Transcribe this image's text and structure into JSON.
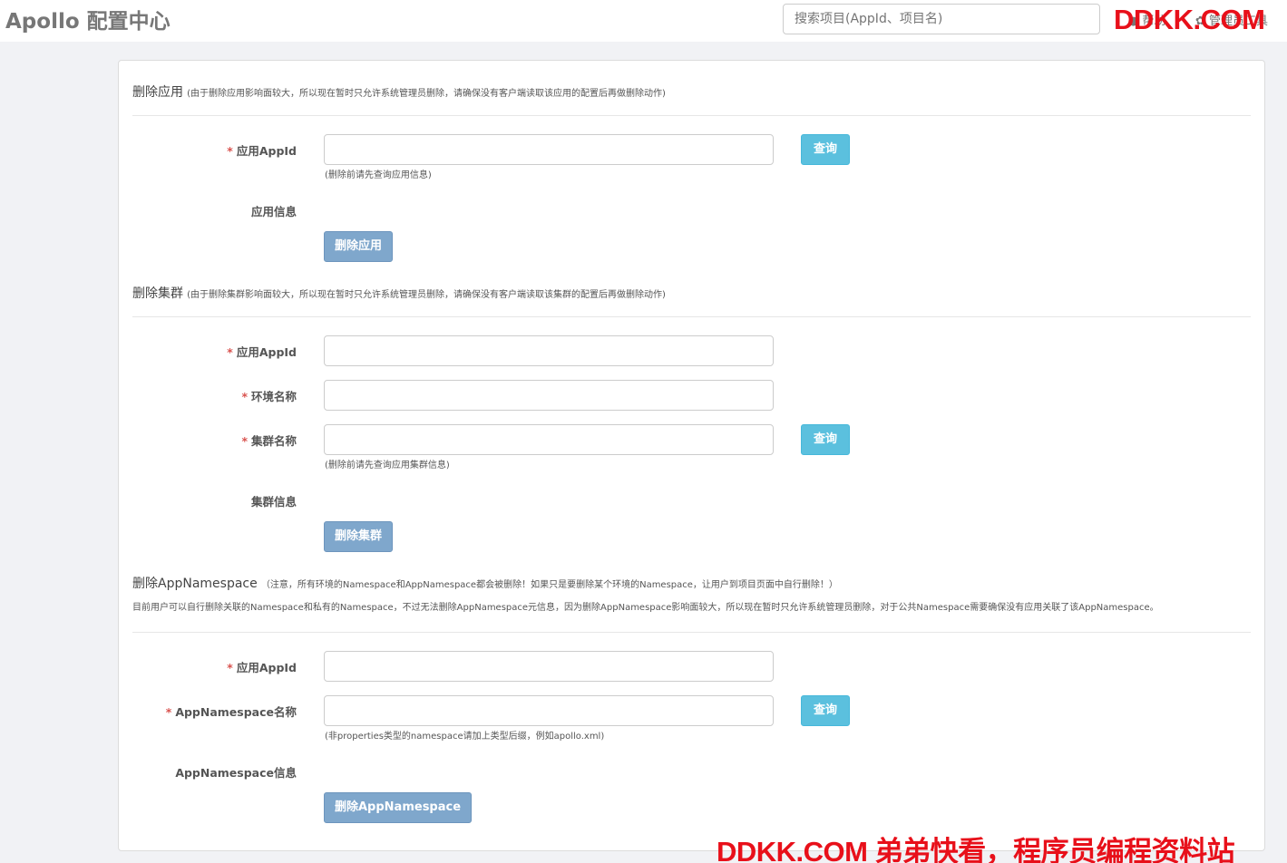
{
  "header": {
    "brand": "Apollo 配置中心",
    "search_placeholder": "搜索项目(AppId、项目名)",
    "help_label": "● 帮助",
    "admin_label": "✿ 管理员工具",
    "watermark": "DDKK.COM"
  },
  "delete_app": {
    "title": "删除应用",
    "note": "(由于删除应用影响面较大，所以现在暂时只允许系统管理员删除，请确保没有客户端读取该应用的配置后再做删除动作)",
    "appid_label": "应用AppId",
    "appid_hint": "(删除前请先查询应用信息)",
    "query_label": "查询",
    "info_label": "应用信息",
    "delete_label": "删除应用"
  },
  "delete_cluster": {
    "title": "删除集群",
    "note": "(由于删除集群影响面较大，所以现在暂时只允许系统管理员删除，请确保没有客户端读取该集群的配置后再做删除动作)",
    "appid_label": "应用AppId",
    "env_label": "环境名称",
    "cluster_label": "集群名称",
    "cluster_hint": "(删除前请先查询应用集群信息)",
    "query_label": "查询",
    "info_label": "集群信息",
    "delete_label": "删除集群"
  },
  "delete_namespace": {
    "title": "删除AppNamespace",
    "note": "（注意，所有环境的Namespace和AppNamespace都会被删除！如果只是要删除某个环境的Namespace，让用户到项目页面中自行删除！）",
    "description": "目前用户可以自行删除关联的Namespace和私有的Namespace，不过无法删除AppNamespace元信息，因为删除AppNamespace影响面较大，所以现在暂时只允许系统管理员删除，对于公共Namespace需要确保没有应用关联了该AppNamespace。",
    "appid_label": "应用AppId",
    "ns_label": "AppNamespace名称",
    "ns_hint": "(非properties类型的namespace请加上类型后缀，例如apollo.xml)",
    "query_label": "查询",
    "info_label": "AppNamespace信息",
    "delete_label": "删除AppNamespace"
  },
  "footer_watermark": "DDKK.COM 弟弟快看，程序员编程资料站"
}
